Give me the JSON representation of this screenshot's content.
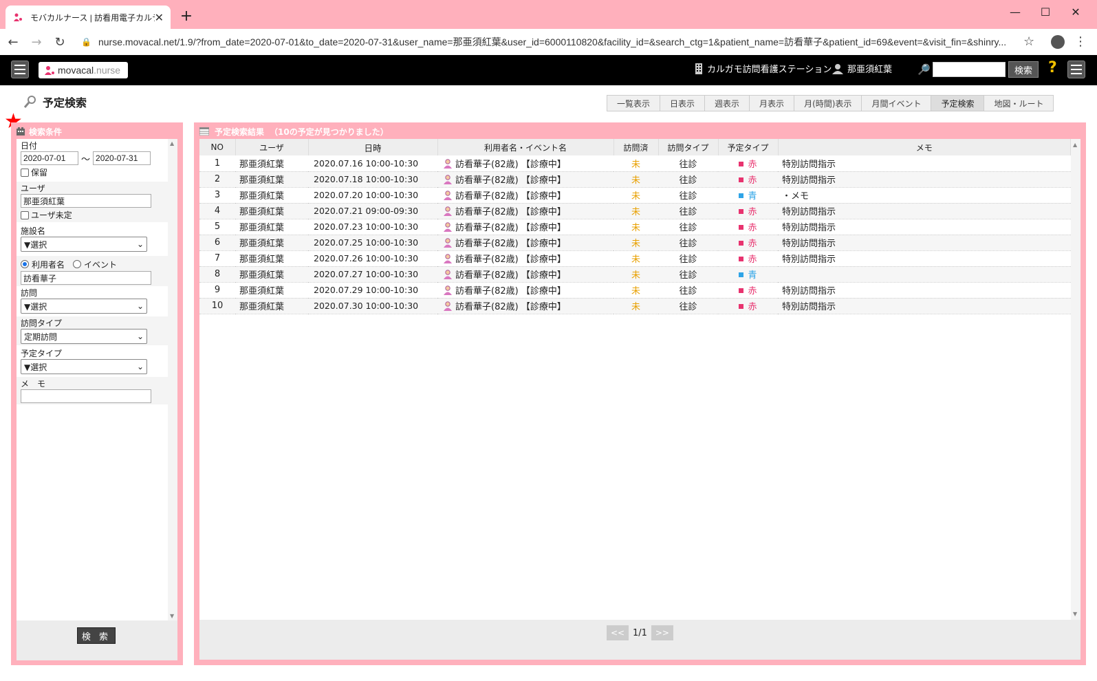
{
  "browser": {
    "tab_title": "モバカルナース | 訪看用電子カルテ",
    "url": "nurse.movacal.net/1.9/?from_date=2020-07-01&to_date=2020-07-31&user_name=那亜須紅葉&user_id=6000110820&facility_id=&search_ctg=1&patient_name=訪看華子&patient_id=69&event=&visit_fin=&shinry..."
  },
  "header": {
    "logo_a": "movacal",
    "logo_b": ".nurse",
    "facility": "カルガモ訪問看護ステーション",
    "user": "那亜須紅葉",
    "search_value": "",
    "search_button": "検索",
    "help": "?"
  },
  "page_title": "予定検索",
  "view_tabs": [
    "一覧表示",
    "日表示",
    "週表示",
    "月表示",
    "月(時間)表示",
    "月間イベント",
    "予定検索",
    "地図・ルート"
  ],
  "active_tab": "予定検索",
  "filter": {
    "title": "検索条件",
    "date_label": "日付",
    "from_date": "2020-07-01",
    "tilde": "～",
    "to_date": "2020-07-31",
    "hold_label": "保留",
    "user_label": "ユーザ",
    "user_value": "那亜須紅葉",
    "user_unset_label": "ユーザ未定",
    "facility_label": "施設名",
    "facility_value": "▼選択",
    "radio_patient": "利用者名",
    "radio_event": "イベント",
    "patient_value": "訪看華子",
    "visit_label": "訪問",
    "visit_value": "▼選択",
    "visit_type_label": "訪問タイプ",
    "visit_type_value": "定期訪問",
    "schedule_type_label": "予定タイプ",
    "schedule_type_value": "▼選択",
    "memo_label": "メ　モ",
    "memo_value": "",
    "search_button": "検 索"
  },
  "results": {
    "title": "予定検索結果",
    "count_text": "（10の予定が見つかりました）",
    "columns": [
      "NO",
      "ユーザ",
      "日時",
      "利用者名・イベント名",
      "訪問済",
      "訪問タイプ",
      "予定タイプ",
      "メモ"
    ],
    "rows": [
      {
        "no": "1",
        "user": "那亜須紅葉",
        "datetime": "2020.07.16 10:00-10:30",
        "patient": "訪看華子(82歳) 【診療中】",
        "visited": "未",
        "visit_type": "往診",
        "schedule_type": "赤",
        "memo": "特別訪問指示"
      },
      {
        "no": "2",
        "user": "那亜須紅葉",
        "datetime": "2020.07.18 10:00-10:30",
        "patient": "訪看華子(82歳) 【診療中】",
        "visited": "未",
        "visit_type": "往診",
        "schedule_type": "赤",
        "memo": "特別訪問指示"
      },
      {
        "no": "3",
        "user": "那亜須紅葉",
        "datetime": "2020.07.20 10:00-10:30",
        "patient": "訪看華子(82歳) 【診療中】",
        "visited": "未",
        "visit_type": "往診",
        "schedule_type": "青",
        "memo": "・メモ"
      },
      {
        "no": "4",
        "user": "那亜須紅葉",
        "datetime": "2020.07.21 09:00-09:30",
        "patient": "訪看華子(82歳) 【診療中】",
        "visited": "未",
        "visit_type": "往診",
        "schedule_type": "赤",
        "memo": "特別訪問指示"
      },
      {
        "no": "5",
        "user": "那亜須紅葉",
        "datetime": "2020.07.23 10:00-10:30",
        "patient": "訪看華子(82歳) 【診療中】",
        "visited": "未",
        "visit_type": "往診",
        "schedule_type": "赤",
        "memo": "特別訪問指示"
      },
      {
        "no": "6",
        "user": "那亜須紅葉",
        "datetime": "2020.07.25 10:00-10:30",
        "patient": "訪看華子(82歳) 【診療中】",
        "visited": "未",
        "visit_type": "往診",
        "schedule_type": "赤",
        "memo": "特別訪問指示"
      },
      {
        "no": "7",
        "user": "那亜須紅葉",
        "datetime": "2020.07.26 10:00-10:30",
        "patient": "訪看華子(82歳) 【診療中】",
        "visited": "未",
        "visit_type": "往診",
        "schedule_type": "赤",
        "memo": "特別訪問指示"
      },
      {
        "no": "8",
        "user": "那亜須紅葉",
        "datetime": "2020.07.27 10:00-10:30",
        "patient": "訪看華子(82歳) 【診療中】",
        "visited": "未",
        "visit_type": "往診",
        "schedule_type": "青",
        "memo": ""
      },
      {
        "no": "9",
        "user": "那亜須紅葉",
        "datetime": "2020.07.29 10:00-10:30",
        "patient": "訪看華子(82歳) 【診療中】",
        "visited": "未",
        "visit_type": "往診",
        "schedule_type": "赤",
        "memo": "特別訪問指示"
      },
      {
        "no": "10",
        "user": "那亜須紅葉",
        "datetime": "2020.07.30 10:00-10:30",
        "patient": "訪看華子(82歳) 【診療中】",
        "visited": "未",
        "visit_type": "往診",
        "schedule_type": "赤",
        "memo": "特別訪問指示"
      }
    ]
  },
  "pager": {
    "prev": "<<",
    "page": "1/1",
    "next": ">>"
  },
  "colors": {
    "accent": "#ffb0bc",
    "red": "#e8336f",
    "blue": "#2fa4e7",
    "pending": "#e8a000"
  }
}
